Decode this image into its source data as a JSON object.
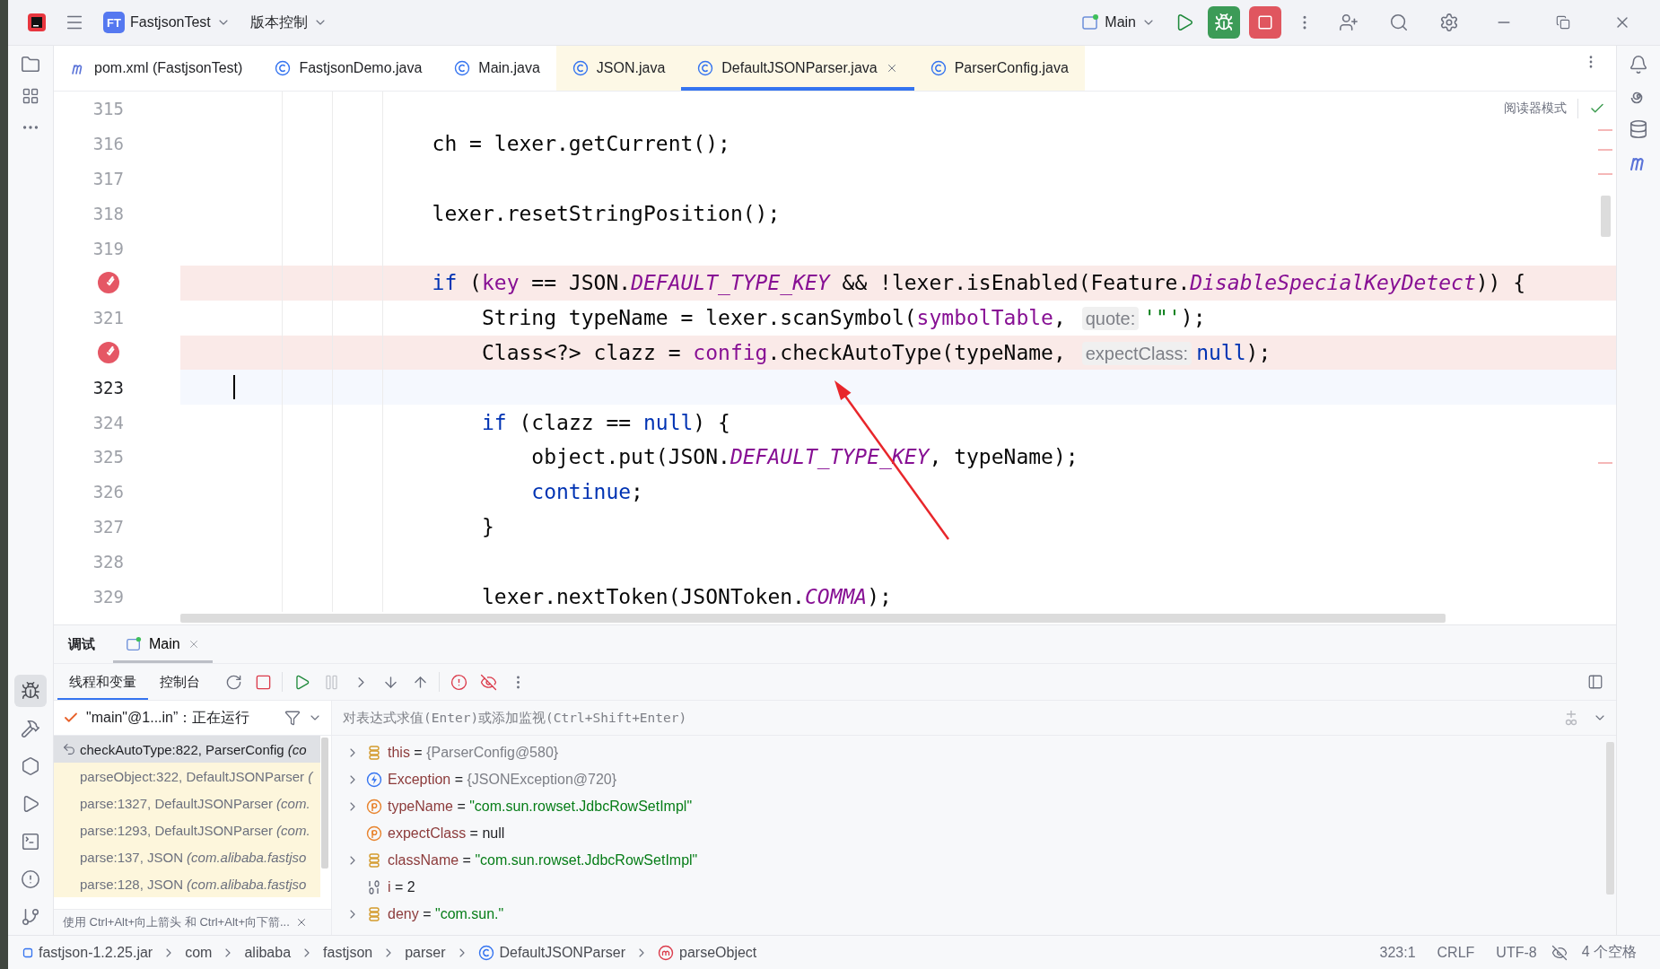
{
  "title_bar": {
    "project_badge": "FT",
    "project": "FastjsonTest",
    "vcs": "版本控制",
    "run_config": "Main"
  },
  "editor_tabs": [
    {
      "kind": "maven",
      "label": "pom.xml (FastjsonTest)",
      "selected": false,
      "library": false
    },
    {
      "kind": "class",
      "label": "FastjsonDemo.java",
      "selected": false,
      "library": false
    },
    {
      "kind": "class",
      "label": "Main.java",
      "selected": false,
      "library": false
    },
    {
      "kind": "class",
      "label": "JSON.java",
      "selected": false,
      "library": true
    },
    {
      "kind": "class",
      "label": "DefaultJSONParser.java",
      "selected": true,
      "library": true
    },
    {
      "kind": "class",
      "label": "ParserConfig.java",
      "selected": false,
      "library": true
    }
  ],
  "editor": {
    "reader_mode": "阅读器模式",
    "code_lines": [
      {
        "number": "315",
        "breakpoint": false,
        "current": false
      },
      {
        "number": "316",
        "breakpoint": false,
        "current": false,
        "tokens": [
          {
            "kind": "plain",
            "text": "                ch = lexer.getCurrent();"
          }
        ]
      },
      {
        "number": "317",
        "breakpoint": false,
        "current": false
      },
      {
        "number": "318",
        "breakpoint": false,
        "current": false,
        "tokens": [
          {
            "kind": "plain",
            "text": "                lexer.resetStringPosition();"
          }
        ]
      },
      {
        "number": "319",
        "breakpoint": false,
        "current": false
      },
      {
        "breakpoint": true,
        "current": false,
        "tokens": [
          {
            "kind": "keyword",
            "text": "                if"
          },
          {
            "kind": "plain",
            "text": " ("
          },
          {
            "kind": "field",
            "text": "key"
          },
          {
            "kind": "plain",
            "text": " == JSON."
          },
          {
            "kind": "static",
            "text": "DEFAULT_TYPE_KEY"
          },
          {
            "kind": "plain",
            "text": " && !lexer.isEnabled(Feature."
          },
          {
            "kind": "static",
            "text": "DisableSpecialKeyDetect"
          },
          {
            "kind": "plain",
            "text": ")) {"
          }
        ]
      },
      {
        "number": "321",
        "breakpoint": false,
        "current": false,
        "tokens": [
          {
            "kind": "plain",
            "text": "                    String typeName = lexer.scanSymbol("
          },
          {
            "kind": "field",
            "text": "symbolTable"
          },
          {
            "kind": "plain",
            "text": ", "
          },
          {
            "kind": "hint",
            "text": "quote:"
          },
          {
            "kind": "string",
            "text": "'\"'"
          },
          {
            "kind": "plain",
            "text": ");"
          }
        ]
      },
      {
        "breakpoint": true,
        "current": false,
        "tokens": [
          {
            "kind": "plain",
            "text": "                    Class<?> clazz = "
          },
          {
            "kind": "field",
            "text": "config"
          },
          {
            "kind": "plain",
            "text": ".checkAutoType(typeName, "
          },
          {
            "kind": "hint",
            "text": "expectClass:"
          },
          {
            "kind": "keyword",
            "text": "null"
          },
          {
            "kind": "plain",
            "text": ");"
          }
        ]
      },
      {
        "number": "323",
        "breakpoint": false,
        "current": true
      },
      {
        "number": "324",
        "breakpoint": false,
        "current": false,
        "tokens": [
          {
            "kind": "keyword",
            "text": "                    if"
          },
          {
            "kind": "plain",
            "text": " (clazz == "
          },
          {
            "kind": "keyword",
            "text": "null"
          },
          {
            "kind": "plain",
            "text": ") {"
          }
        ]
      },
      {
        "number": "325",
        "breakpoint": false,
        "current": false,
        "tokens": [
          {
            "kind": "plain",
            "text": "                        object.put(JSON."
          },
          {
            "kind": "static",
            "text": "DEFAULT_TYPE_KEY"
          },
          {
            "kind": "plain",
            "text": ", typeName);"
          }
        ]
      },
      {
        "number": "326",
        "breakpoint": false,
        "current": false,
        "tokens": [
          {
            "kind": "keyword",
            "text": "                        continue"
          },
          {
            "kind": "plain",
            "text": ";"
          }
        ]
      },
      {
        "number": "327",
        "breakpoint": false,
        "current": false,
        "tokens": [
          {
            "kind": "plain",
            "text": "                    }"
          }
        ]
      },
      {
        "number": "328",
        "breakpoint": false,
        "current": false
      },
      {
        "number": "329",
        "breakpoint": false,
        "current": false,
        "tokens": [
          {
            "kind": "plain",
            "text": "                    lexer.nextToken(JSONToken."
          },
          {
            "kind": "static",
            "text": "COMMA"
          },
          {
            "kind": "plain",
            "text": ");"
          }
        ]
      }
    ]
  },
  "debug": {
    "title": "调试",
    "session_tab": {
      "label": "Main",
      "selected": true
    },
    "view_tabs": [
      {
        "label": "线程和变量",
        "selected": true
      },
      {
        "label": "控制台",
        "selected": false
      }
    ],
    "toolbar": [
      {
        "kind": "rerun",
        "disabled": false
      },
      {
        "kind": "stop",
        "disabled": false
      },
      {
        "kind": "resume",
        "disabled": false
      },
      {
        "kind": "pause",
        "disabled": true
      },
      {
        "kind": "step_over",
        "disabled": false
      },
      {
        "kind": "step_into",
        "disabled": false
      },
      {
        "kind": "step_out",
        "disabled": false
      },
      {
        "kind": "breakpoints",
        "disabled": false
      },
      {
        "kind": "mute",
        "disabled": false
      },
      {
        "kind": "more",
        "disabled": false
      }
    ],
    "thread": "\"main\"@1...in”：正在运行",
    "frames": [
      {
        "method": "checkAutoType:822, ParserConfig",
        "package": "(co",
        "selected": true,
        "library": false
      },
      {
        "method": "parseObject:322, DefaultJSONParser",
        "package": "(",
        "selected": false,
        "library": true
      },
      {
        "method": "parse:1327, DefaultJSONParser",
        "package": "(com.",
        "selected": false,
        "library": true
      },
      {
        "method": "parse:1293, DefaultJSONParser",
        "package": "(com.",
        "selected": false,
        "library": true
      },
      {
        "method": "parse:137, JSON",
        "package": "(com.alibaba.fastjso",
        "selected": false,
        "library": true
      },
      {
        "method": "parse:128, JSON",
        "package": "(com.alibaba.fastjso",
        "selected": false,
        "library": true
      }
    ],
    "hint": "使用 Ctrl+Alt+向上箭头 和 Ctrl+Alt+向下箭...",
    "evaluate": {
      "placeholder": "对表达式求值(Enter)或添加监视(Ctrl+Shift+Enter)"
    },
    "variables": [
      {
        "expandable": true,
        "kind": "field",
        "name": "this",
        "operator": "=",
        "value": {
          "kind": "object",
          "text": "{ParserConfig@580}"
        }
      },
      {
        "expandable": true,
        "kind": "exception",
        "name": "Exception",
        "operator": "=",
        "value": {
          "kind": "object",
          "text": "{JSONException@720}"
        }
      },
      {
        "expandable": true,
        "kind": "param",
        "name": "typeName",
        "operator": "=",
        "value": {
          "kind": "string",
          "text": "\"com.sun.rowset.JdbcRowSetImpl\""
        }
      },
      {
        "expandable": false,
        "kind": "param",
        "name": "expectClass",
        "operator": "=",
        "value": {
          "kind": "literal",
          "text": "null"
        }
      },
      {
        "expandable": true,
        "kind": "field",
        "name": "className",
        "operator": "=",
        "value": {
          "kind": "string",
          "text": "\"com.sun.rowset.JdbcRowSetImpl\""
        }
      },
      {
        "expandable": false,
        "kind": "primitive",
        "name": "i",
        "operator": "=",
        "value": {
          "kind": "literal",
          "text": "2"
        }
      },
      {
        "expandable": true,
        "kind": "field",
        "name": "deny",
        "operator": "=",
        "value": {
          "kind": "string",
          "text": "\"com.sun.\""
        }
      }
    ]
  },
  "status_bar": {
    "breadcrumbs": [
      {
        "kind": "jar",
        "label": "fastjson-1.2.25.jar"
      },
      {
        "kind": "package",
        "label": "com"
      },
      {
        "kind": "package",
        "label": "alibaba"
      },
      {
        "kind": "package",
        "label": "fastjson"
      },
      {
        "kind": "package",
        "label": "parser"
      },
      {
        "kind": "class",
        "label": "DefaultJSONParser"
      },
      {
        "kind": "method",
        "label": "parseObject"
      }
    ],
    "position": "323:1",
    "line_separator": "CRLF",
    "encoding": "UTF-8",
    "indent": "4 个空格"
  }
}
